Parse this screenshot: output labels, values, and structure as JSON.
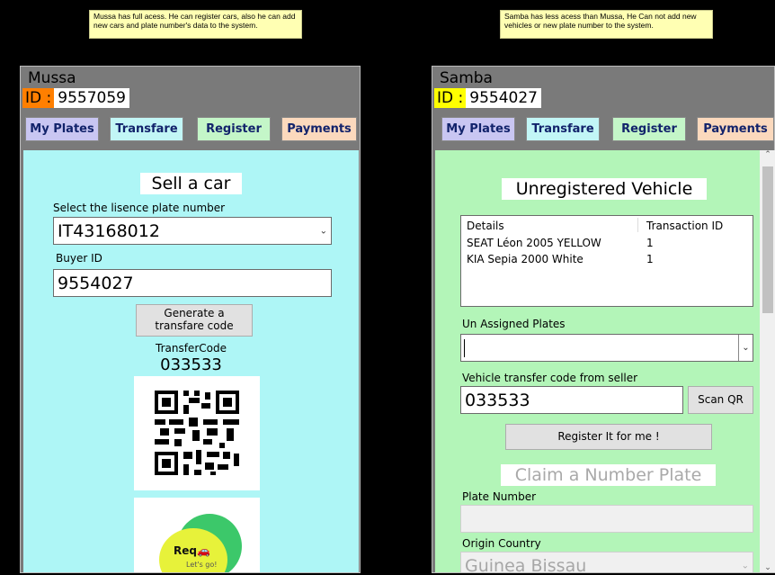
{
  "notes": {
    "left": "Mussa has full acess. He can register cars, also he can add new cars and plate number's data to the system.",
    "right": "Samba has less acess than Mussa, He Can not add new vehicles or new plate number to the system."
  },
  "left_panel": {
    "user_name": "Mussa",
    "id_label": "ID :",
    "id_value": "9557059",
    "id_label_color": "#ff7f00",
    "tabs": [
      "My Plates",
      "Transfare",
      "Register",
      "Payments"
    ],
    "content_bg": "#aef6f6",
    "heading": "Sell a car",
    "plate_select_label": "Select the lisence plate number",
    "plate_selected": "IT43168012",
    "buyer_label": "Buyer ID",
    "buyer_value": "9554027",
    "generate_button": "Generate a transfare code",
    "transfer_code_label": "TransferCode",
    "transfer_code_value": "033533",
    "qr_icon": "qr-code",
    "logo_text": "Req",
    "logo_subtext": "Let's go!"
  },
  "right_panel": {
    "user_name": "Samba",
    "id_label": "ID :",
    "id_value": "9554027",
    "id_label_color": "#ffff00",
    "tabs": [
      "My Plates",
      "Transfare",
      "Register",
      "Payments"
    ],
    "content_bg": "#b3f5b8",
    "heading": "Unregistered Vehicle",
    "table": {
      "columns": [
        "Details",
        "Transaction ID"
      ],
      "rows": [
        [
          "SEAT Léon 2005 YELLOW",
          "1"
        ],
        [
          "KIA Sepia 2000 White",
          "1"
        ]
      ]
    },
    "unassigned_label": "Un Assigned Plates",
    "unassigned_value": "",
    "transfer_code_label": "Vehicle transfer code from seller",
    "transfer_code_value": "033533",
    "scan_button": "Scan QR",
    "register_button": "Register It for me !",
    "claim_heading": "Claim a Number Plate",
    "plate_number_label": "Plate Number",
    "plate_number_value": "",
    "origin_label": "Origin Country",
    "origin_value": "Guinea Bissau"
  }
}
